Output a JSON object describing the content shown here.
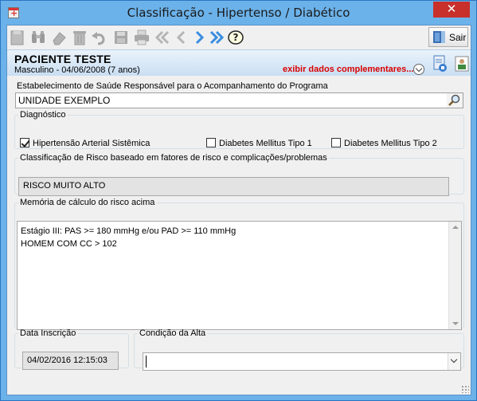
{
  "window": {
    "title": "Classificação - Hipertenso / Diabético",
    "close_label": "✕"
  },
  "toolbar": {
    "buttons": [
      "new-icon",
      "search-binoculars-icon",
      "eraser-icon",
      "trash-icon",
      "undo-icon",
      "save-icon",
      "print-icon",
      "first-record-icon",
      "previous-record-icon",
      "next-record-icon",
      "last-record-icon",
      "help-icon"
    ],
    "sair_label": "Sair"
  },
  "patient": {
    "name": "PACIENTE TESTE",
    "info": "Masculino - 04/06/2008 (7 anos)",
    "extra_link": "exibir dados complementares...",
    "extra_color": "#d90000"
  },
  "estabelecimento": {
    "label": "Estabelecimento de Saúde Responsável para o Acompanhamento do Programa",
    "value": "UNIDADE EXEMPLO"
  },
  "diagnostico": {
    "legend": "Diagnóstico",
    "options": [
      {
        "label": "Hipertensão Arterial Sistêmica",
        "checked": true
      },
      {
        "label": "Diabetes Mellitus Tipo 1",
        "checked": false
      },
      {
        "label": "Diabetes Mellitus Tipo 2",
        "checked": false
      }
    ]
  },
  "risco": {
    "legend": "Classificação de Risco baseado em fatores de risco e complicações/problemas",
    "value": "RISCO MUITO ALTO"
  },
  "memoria": {
    "legend": "Memória de cálculo do risco acima",
    "lines": [
      "Estágio III: PAS >= 180 mmHg e/ou PAD >= 110 mmHg",
      "HOMEM COM CC > 102"
    ]
  },
  "data_inscricao": {
    "legend": "Data Inscrição",
    "value": "04/02/2016 12:15:03"
  },
  "condicao_alta": {
    "legend": "Condição da Alta",
    "value": ""
  }
}
